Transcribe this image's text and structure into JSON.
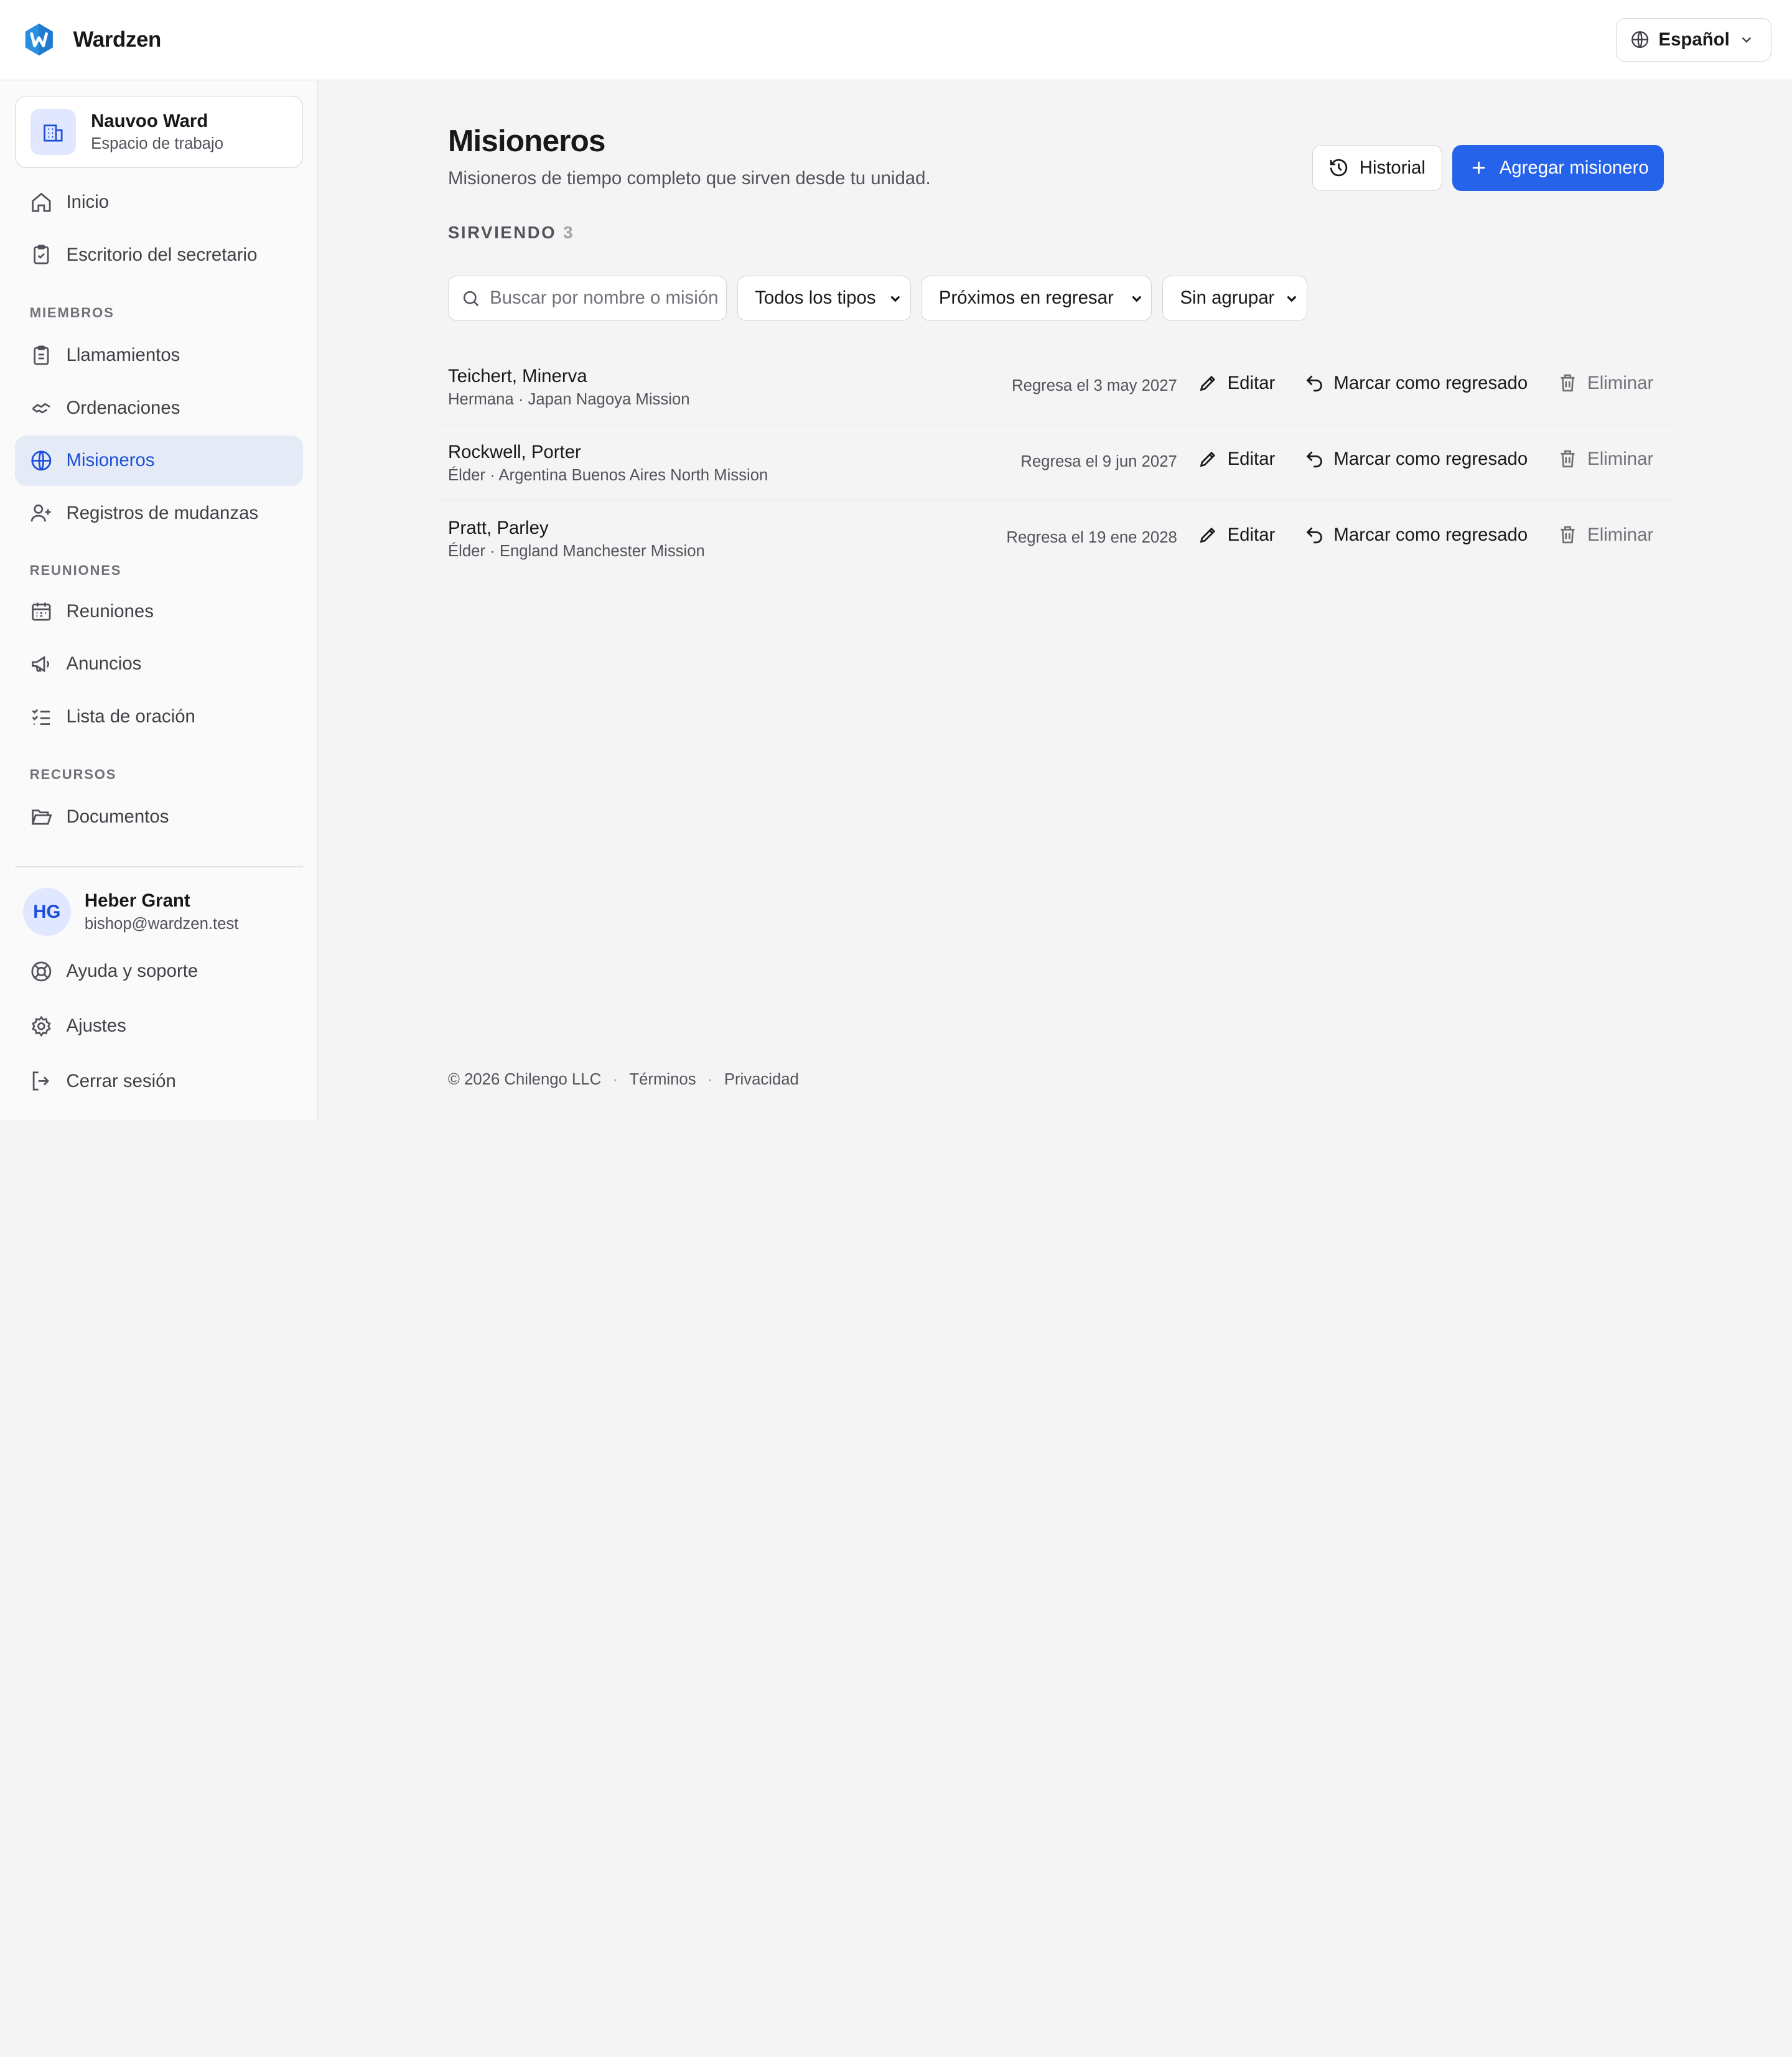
{
  "app": {
    "brand_name": "Wardzen",
    "language_label": "Español"
  },
  "workspace": {
    "name": "Nauvoo Ward",
    "subtitle": "Espacio de trabajo"
  },
  "sidebar": {
    "items": [
      {
        "label": "Inicio",
        "icon": "home-icon"
      },
      {
        "label": "Escritorio del secretario",
        "icon": "clipboard-check-icon"
      }
    ],
    "sections": [
      {
        "title": "MIEMBROS",
        "items": [
          {
            "label": "Llamamientos",
            "icon": "clipboard-list-icon"
          },
          {
            "label": "Ordenaciones",
            "icon": "handshake-icon"
          },
          {
            "label": "Misioneros",
            "icon": "globe-icon",
            "active": true
          },
          {
            "label": "Registros de mudanzas",
            "icon": "user-plus-icon"
          }
        ]
      },
      {
        "title": "REUNIONES",
        "items": [
          {
            "label": "Reuniones",
            "icon": "calendar-icon"
          },
          {
            "label": "Anuncios",
            "icon": "megaphone-icon"
          },
          {
            "label": "Lista de oración",
            "icon": "list-checks-icon"
          }
        ]
      },
      {
        "title": "RECURSOS",
        "items": [
          {
            "label": "Documentos",
            "icon": "folder-open-icon"
          }
        ]
      }
    ],
    "user": {
      "initials": "HG",
      "name": "Heber Grant",
      "email": "bishop@wardzen.test"
    },
    "bottom_items": [
      {
        "label": "Ayuda y soporte",
        "icon": "life-buoy-icon"
      },
      {
        "label": "Ajustes",
        "icon": "gear-icon"
      },
      {
        "label": "Cerrar sesión",
        "icon": "log-out-icon"
      }
    ]
  },
  "page": {
    "title": "Misioneros",
    "subtitle": "Misioneros de tiempo completo que sirven desde tu unidad.",
    "history_button": "Historial",
    "add_button": "Agregar misionero",
    "section_label": "SIRVIENDO",
    "section_count": "3"
  },
  "filters": {
    "search_placeholder": "Buscar por nombre o misión",
    "type_select": "Todos los tipos",
    "sort_select": "Próximos en regresar",
    "group_select": "Sin agrupar"
  },
  "actions": {
    "edit": "Editar",
    "mark_returned": "Marcar como regresado",
    "delete": "Eliminar"
  },
  "missionaries": [
    {
      "name": "Teichert, Minerva",
      "meta": "Hermana · Japan Nagoya Mission",
      "return": "Regresa el 3 may 2027"
    },
    {
      "name": "Rockwell, Porter",
      "meta": "Élder · Argentina Buenos Aires North Mission",
      "return": "Regresa el 9 jun 2027"
    },
    {
      "name": "Pratt, Parley",
      "meta": "Élder · England Manchester Mission",
      "return": "Regresa el 19 ene 2028"
    }
  ],
  "footer": {
    "copyright": "© 2026 Chilengo LLC",
    "terms": "Términos",
    "privacy": "Privacidad"
  },
  "colors": {
    "accent": "#2563eb",
    "active_bg": "#e4eaf6",
    "active_text": "#1d4ed8",
    "logo": "#2b8fe0"
  }
}
